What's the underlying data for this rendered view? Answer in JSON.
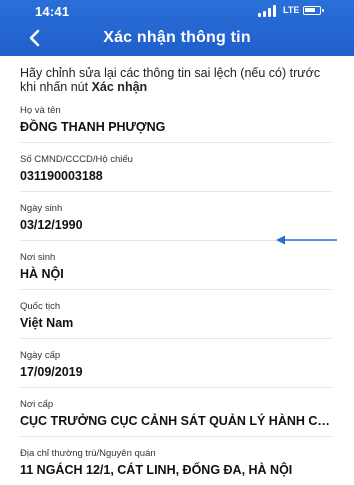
{
  "status_bar": {
    "time": "14:41",
    "network": "LTE"
  },
  "header": {
    "title": "Xác nhận thông tin",
    "back_icon": "chevron-left-icon"
  },
  "intro": {
    "text": "Hãy chỉnh sửa lại các thông tin sai lệch (nếu có) trước khi nhấn nút ",
    "emphasis": "Xác nhận"
  },
  "fields": [
    {
      "label": "Họ và tên",
      "value": "ĐỒNG THANH PHƯỢNG"
    },
    {
      "label": "Số CMND/CCCD/Hộ chiếu",
      "value": "031190003188"
    },
    {
      "label": "Ngày sinh",
      "value": "03/12/1990"
    },
    {
      "label": "Nơi sinh",
      "value": "HÀ NỘI"
    },
    {
      "label": "Quốc tịch",
      "value": "Việt Nam"
    },
    {
      "label": "Ngày cấp",
      "value": "17/09/2019"
    },
    {
      "label": "Nơi cấp",
      "value": "CỤC TRƯỞNG CỤC CẢNH SÁT QUẢN LÝ HÀNH CHÍN..."
    },
    {
      "label": "Địa chỉ thường trú/Nguyên quán",
      "value": "11 NGÁCH 12/1, CÁT LINH, ĐỐNG ĐA, HÀ NỘI"
    }
  ],
  "colors": {
    "header": "#1f5fcc",
    "arrow": "#2a6fd6"
  }
}
